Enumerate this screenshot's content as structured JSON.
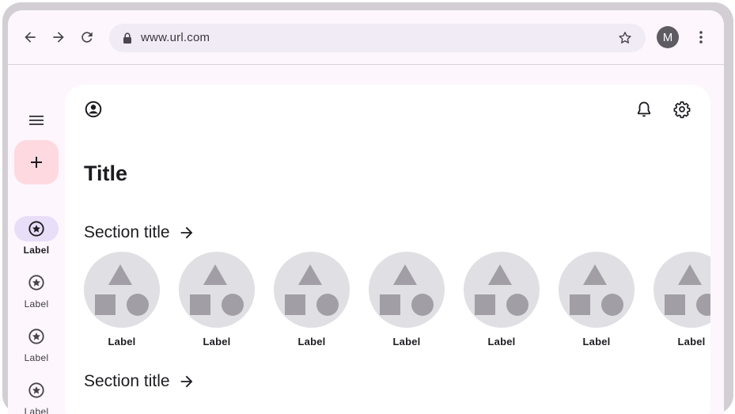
{
  "browser": {
    "url": "www.url.com",
    "avatar_initial": "M",
    "nav_icons": [
      "back-arrow-icon",
      "forward-arrow-icon",
      "reload-icon"
    ]
  },
  "nav_rail": {
    "fab_icon": "plus-icon",
    "items": [
      {
        "label": "Label",
        "active": true
      },
      {
        "label": "Label",
        "active": false
      },
      {
        "label": "Label",
        "active": false
      },
      {
        "label": "Label",
        "active": false
      }
    ]
  },
  "main": {
    "title": "Title",
    "sections": [
      {
        "title": "Section title",
        "items": [
          {
            "label": "Label"
          },
          {
            "label": "Label"
          },
          {
            "label": "Label"
          },
          {
            "label": "Label"
          },
          {
            "label": "Label"
          },
          {
            "label": "Label"
          },
          {
            "label": "Label"
          }
        ]
      },
      {
        "title": "Section title",
        "items": []
      }
    ]
  },
  "colors": {
    "fab_background": "#ffd9e0",
    "active_indicator": "#e8def8",
    "placeholder_circle": "#e0dfe3",
    "placeholder_shapes": "#a19ea5"
  }
}
